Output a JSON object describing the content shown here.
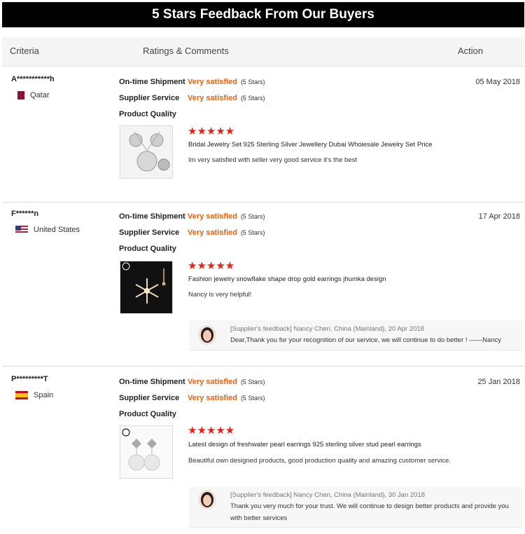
{
  "banner": {
    "title": "5 Stars Feedback From Our Buyers"
  },
  "table_header": {
    "criteria": "Criteria",
    "ratings": "Ratings & Comments",
    "action": "Action"
  },
  "stars": "★★★★★",
  "colors": {
    "accent_orange": "#e8620c",
    "star_red": "#e62117",
    "banner_bg": "#000000"
  },
  "reviews": [
    {
      "buyer": "A***********h",
      "country": "Qatar",
      "flag_icon": "flag-qatar-icon",
      "date": "05 May 2018",
      "criteria": [
        {
          "label": "On-time Shipment",
          "value": "Very satisfied",
          "stars": "(5 Stars)"
        },
        {
          "label": "Supplier Service",
          "value": "Very satisfied",
          "stars": "(5 Stars)"
        },
        {
          "label": "Product Quality",
          "value": "",
          "stars": ""
        }
      ],
      "product_title": "Bridal Jewelry Set 925 Sterling Silver Jewellery Dubai Wholesale Jewelry Set Price",
      "comment": "Im very satisfied with seller very good service it's the best"
    },
    {
      "buyer": "F******n",
      "country": "United States",
      "flag_icon": "flag-us-icon",
      "date": "17 Apr 2018",
      "criteria": [
        {
          "label": "On-time Shipment",
          "value": "Very satisfied",
          "stars": "(5 Stars)"
        },
        {
          "label": "Supplier Service",
          "value": "Very satisfied",
          "stars": "(5 Stars)"
        },
        {
          "label": "Product Quality",
          "value": "",
          "stars": ""
        }
      ],
      "product_title": "Fashion jewelry snowflake shape drop gold earrings jhumka design",
      "comment": "Nancy is very helpful!",
      "supplier_feedback": {
        "meta": "[Supplier's feedback] Nancy Chen, China (Mainland), 20 Apr 2018",
        "text": "Dear,Thank you for your recognition of our service, we will continue to do better ! ——Nancy"
      }
    },
    {
      "buyer": "P*********T",
      "country": "Spain",
      "flag_icon": "flag-spain-icon",
      "date": "25 Jan 2018",
      "criteria": [
        {
          "label": "On-time Shipment",
          "value": "Very satisfied",
          "stars": "(5 Stars)"
        },
        {
          "label": "Supplier Service",
          "value": "Very satisfied",
          "stars": "(5 Stars)"
        },
        {
          "label": "Product Quality",
          "value": "",
          "stars": ""
        }
      ],
      "product_title": "Latest design of freshwater pearl earrings 925 sterling silver stud pearl earrings",
      "comment": "Beautiful own designed products, good production quality and amazing customer service.",
      "supplier_feedback": {
        "meta": "[Supplier's feedback] Nancy Chen, China (Mainland), 30 Jan 2018",
        "text": "Thank you very much for your trust. We will continue to design better products and provide you with better services"
      }
    }
  ]
}
